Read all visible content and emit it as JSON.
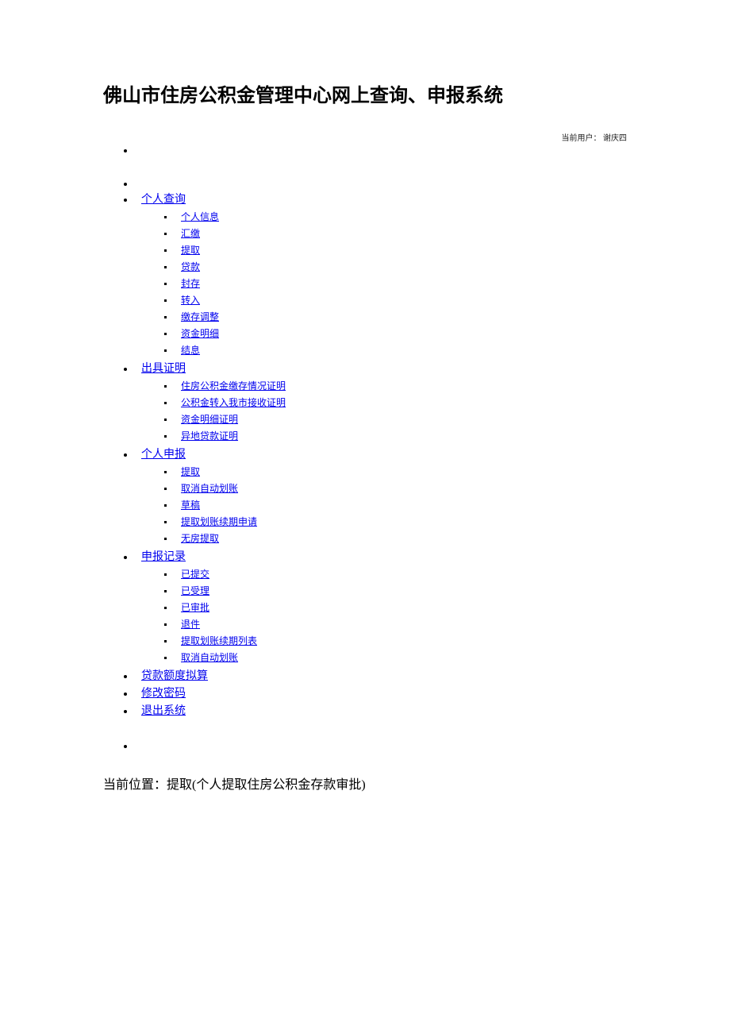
{
  "header": {
    "site_title": "佛山市住房公积金管理中心网上查询、申报系统",
    "current_user_label": "当前用户：",
    "current_user_name": "谢庆四"
  },
  "nav": {
    "sections": [
      {
        "label": "个人查询",
        "items": [
          "个人信息",
          "汇缴",
          "提取",
          "贷款",
          "封存",
          "转入",
          "缴存调整",
          "资金明细",
          "结息"
        ]
      },
      {
        "label": "出具证明",
        "items": [
          "住房公积金缴存情况证明",
          "公积金转入我市接收证明",
          "资金明细证明",
          "异地贷款证明"
        ]
      },
      {
        "label": "个人申报",
        "items": [
          "提取",
          "取消自动划账",
          "草稿",
          "提取划账续期申请",
          "无房提取"
        ]
      },
      {
        "label": "申报记录",
        "items": [
          "已提交",
          "已受理",
          "已审批",
          "退件",
          "提取划账续期列表",
          "取消自动划账"
        ]
      },
      {
        "label": "贷款额度拟算",
        "items": []
      },
      {
        "label": "修改密码",
        "items": []
      },
      {
        "label": "退出系统",
        "items": []
      }
    ]
  },
  "breadcrumb": {
    "label": "当前位置：",
    "value": "提取(个人提取住房公积金存款审批)"
  }
}
